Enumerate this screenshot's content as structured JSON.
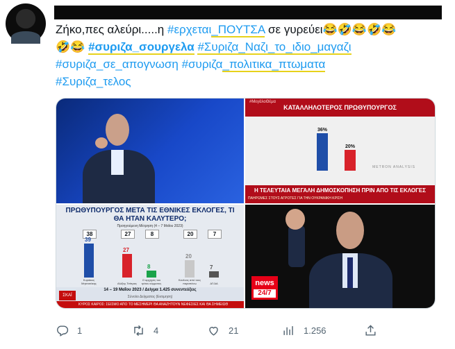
{
  "tweet": {
    "lines": [
      [
        {
          "text": "Ζήκο,πες αλεύρι.....η ",
          "kind": "plain"
        },
        {
          "text": "#ερχεται",
          "kind": "tag"
        },
        {
          "text": "_ΠΟΥΤΣΑ",
          "kind": "tag-hl"
        },
        {
          "text": " σε γυρεύει",
          "kind": "plain"
        },
        {
          "text": "😂🤣😂🤣😂",
          "kind": "plain"
        }
      ],
      [
        {
          "text": "🤣😂 ",
          "kind": "plain"
        },
        {
          "text": "#συριζα_σουργελα",
          "kind": "tag-bold-hl"
        },
        {
          "text": " ",
          "kind": "plain"
        },
        {
          "text": "#Συριζα_Ναζι_το_ιδιο_μαγαζι",
          "kind": "tag-hl"
        }
      ],
      [
        {
          "text": "#συριζα_σε_απογνωση",
          "kind": "tag"
        },
        {
          "text": " ",
          "kind": "plain"
        },
        {
          "text": "#συριζα",
          "kind": "tag"
        },
        {
          "text": "_πολιτικα_πτωματα",
          "kind": "tag-hl"
        }
      ],
      [
        {
          "text": "#Συριζα_τελος",
          "kind": "tag"
        }
      ]
    ]
  },
  "media": {
    "image2": {
      "hashtag": "#ΜεγάλοΘέμα",
      "title": "ΚΑΤΑΛΛΗΛΟΤΕΡΟΣ ΠΡΩΘΥΠΟΥΡΓΟΣ",
      "bars": [
        {
          "value": 36,
          "label": "36",
          "color": "#1f4ea8"
        },
        {
          "value": 20,
          "label": "20",
          "color": "#d8222a"
        }
      ],
      "source": "METRON ANALYSIS",
      "caption": "Η ΤΕΛΕΥΤΑΙΑ ΜΕΓΑΛΗ ΔΗΜΟΣΚΟΠΗΣΗ ΠΡΙΝ ΑΠΟ ΤΙΣ ΕΚΛΟΓΕΣ",
      "ticker": "ΠΑΗΡΩΜΕΣ ΣΤΟΥΣ ΑΓΡΟΤΕΣ ΓΙΑ ΤΗΝ ΟΥΚΡΑΝΙΚΗ ΚΡΙΣΗ"
    },
    "image3": {
      "title": "ΠΡΩΘΥΠΟΥΡΓΟΣ ΜΕΤΑ ΤΙΣ ΕΘΝΙΚΕΣ ΕΚΛΟΓΕΣ, ΤΙ ΘΑ ΗΤΑΝ ΚΑΛΥΤΕΡΟ;",
      "subtitle": "Προηγούμενη Μέτρηση (4 – 7 Μαΐου 2023)",
      "previous": [
        "38",
        "27",
        "8",
        "20",
        "7"
      ],
      "bars": [
        {
          "value": 39,
          "label": "39",
          "color": "#1f4ea8",
          "name": "Κυριάκος Μητσοτάκης"
        },
        {
          "value": 27,
          "label": "27",
          "color": "#d8222a",
          "name": "Αλέξης Τσίπρας"
        },
        {
          "value": 8,
          "label": "8",
          "color": "#1aa34a",
          "name": "Ο αρχηγός του τρίτου κόμματος"
        },
        {
          "value": 20,
          "label": "20",
          "color": "#c8c8c8",
          "name": "Κανένας από τους παραπάνω"
        },
        {
          "value": 7,
          "label": "7",
          "color": "#555555",
          "name": "ΔΓ/ΔΑ"
        }
      ],
      "footer": "14 – 19 Μαΐου 2023 / Δείγμα 1.425 συνεντεύξεις",
      "footer2": "Σύνολο Δείγματος (Εκτιμηση)",
      "logo": "ΣΚΑΪ",
      "ticker": "ΚΥΡΟΣ ΚΑΙΡΟΣ: ΣΕΙΣΜΟ ΑΠΟ ΤΟ ΜΕΣΗΜΕΡΙ ΘΑ ΑΝΑΖΗΤΟΥΝ ΝΕΦΕΣΙΕΣ ΚΑΙ ΘΑ ΣΗΜΕΙΩΘ"
    },
    "image4": {
      "logo_top": "news",
      "logo_bottom": "24/7"
    }
  },
  "actions": {
    "reply": {
      "icon": "reply-icon",
      "count": "1"
    },
    "retweet": {
      "icon": "retweet-icon",
      "count": "4"
    },
    "like": {
      "icon": "heart-icon",
      "count": "21"
    },
    "views": {
      "icon": "views-icon",
      "count": "1.256"
    },
    "share": {
      "icon": "share-icon"
    }
  }
}
